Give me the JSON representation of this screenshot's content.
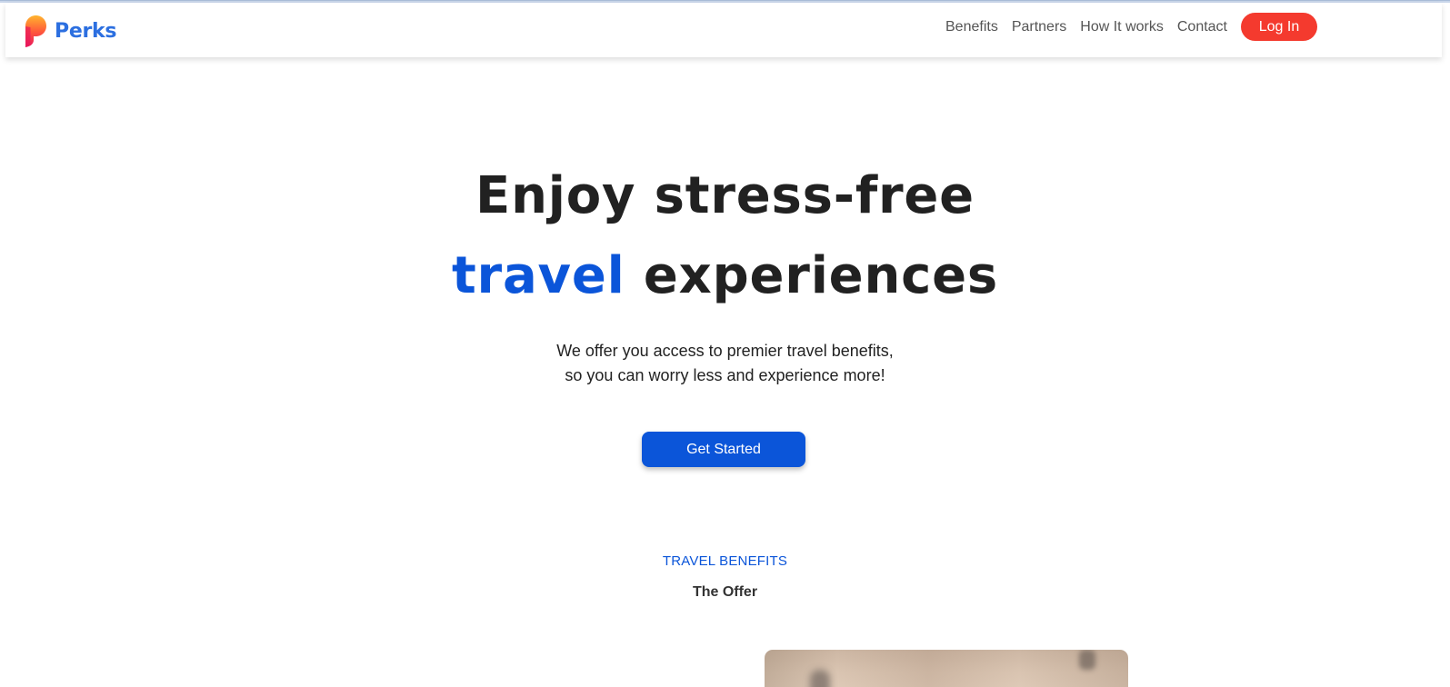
{
  "brand": {
    "name": "Perks",
    "logo_icon": "perks-logo-icon",
    "colors": {
      "primary": "#0b55d9",
      "login": "#f43a2e",
      "logo_text": "#2c6fe0"
    }
  },
  "nav": {
    "links": [
      "Benefits",
      "Partners",
      "How It works",
      "Contact"
    ],
    "login_label": "Log In"
  },
  "hero": {
    "line1": "Enjoy stress-free",
    "line2_accent": "travel",
    "line2_rest": " experiences",
    "subtitle_line1": "We offer you access to premier travel benefits,",
    "subtitle_line2": "so you can worry less and experience more!",
    "cta_label": "Get Started"
  },
  "section": {
    "eyebrow": "TRAVEL BENEFITS",
    "title": "The Offer"
  }
}
